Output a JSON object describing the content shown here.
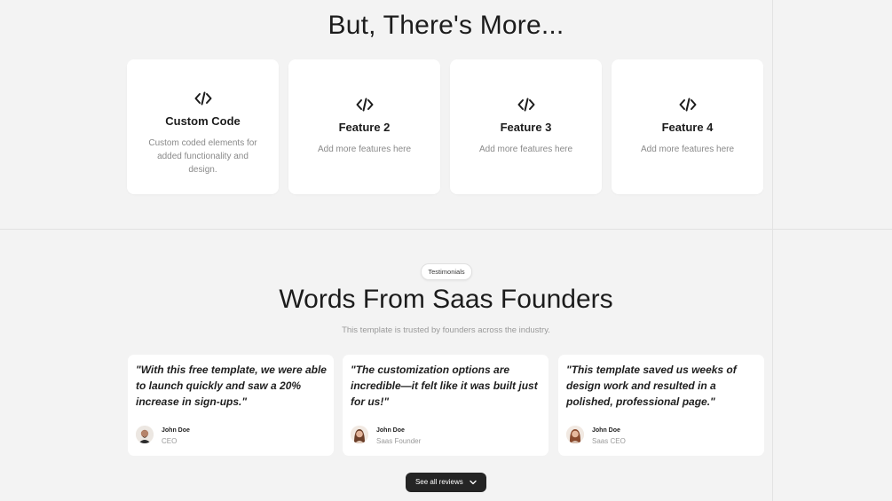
{
  "more_section": {
    "title": "But, There's More...",
    "features": [
      {
        "icon": "code-icon",
        "title": "Custom Code",
        "description": "Custom coded elements for added functionality and design."
      },
      {
        "icon": "code-icon",
        "title": "Feature 2",
        "description": "Add more features here"
      },
      {
        "icon": "code-icon",
        "title": "Feature 3",
        "description": "Add more features here"
      },
      {
        "icon": "code-icon",
        "title": "Feature 4",
        "description": "Add more features here"
      }
    ]
  },
  "testimonials_section": {
    "badge": "Testimonials",
    "title": "Words From Saas Founders",
    "subtitle": "This template is trusted by founders across the industry.",
    "items": [
      {
        "quote": "\"With this free template, we were able to launch quickly and saw a 20% increase in sign-ups.\"",
        "name": "John Doe",
        "role": "CEO"
      },
      {
        "quote": "\"The customization options are incredible—it felt like it was built just for us!\"",
        "name": "John Doe",
        "role": "Saas Founder"
      },
      {
        "quote": "\"This template saved us weeks of design work and resulted in a polished, professional page.\"",
        "name": "John Doe",
        "role": "Saas CEO"
      }
    ],
    "see_all_label": "See all reviews",
    "see_all_icon": "chevron-down-icon"
  }
}
